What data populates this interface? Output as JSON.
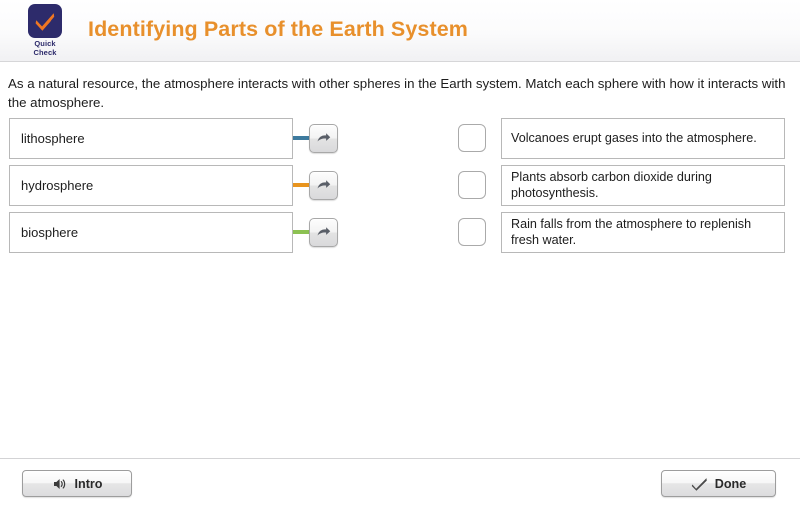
{
  "header": {
    "logo": {
      "icon": "check-icon",
      "caption_line1": "Quick",
      "caption_line2": "Check",
      "tile_color": "#2d2b6b",
      "check_color": "#ef7622"
    },
    "title": "Identifying Parts of the Earth System",
    "title_color": "#e8902c"
  },
  "prompt": "As a natural resource, the atmosphere interacts with other spheres in the Earth system. Match each sphere with how it interacts with the atmosphere.",
  "match": {
    "sources": [
      {
        "label": "lithosphere",
        "connector_color": "#3d7a9e",
        "arrow_icon": "arrow-right-icon"
      },
      {
        "label": "hydrosphere",
        "connector_color": "#e8941e",
        "arrow_icon": "arrow-right-icon"
      },
      {
        "label": "biosphere",
        "connector_color": "#8cc152",
        "arrow_icon": "arrow-right-icon"
      }
    ],
    "targets": [
      {
        "text": "Volcanoes erupt gases into the atmosphere.",
        "drop_value": ""
      },
      {
        "text": "Plants absorb carbon dioxide during photosynthesis.",
        "drop_value": ""
      },
      {
        "text": "Rain falls from the atmosphere to replenish fresh water.",
        "drop_value": ""
      }
    ]
  },
  "footer": {
    "intro_label": "Intro",
    "intro_icon": "speaker-icon",
    "done_label": "Done",
    "done_icon": "check-icon"
  }
}
